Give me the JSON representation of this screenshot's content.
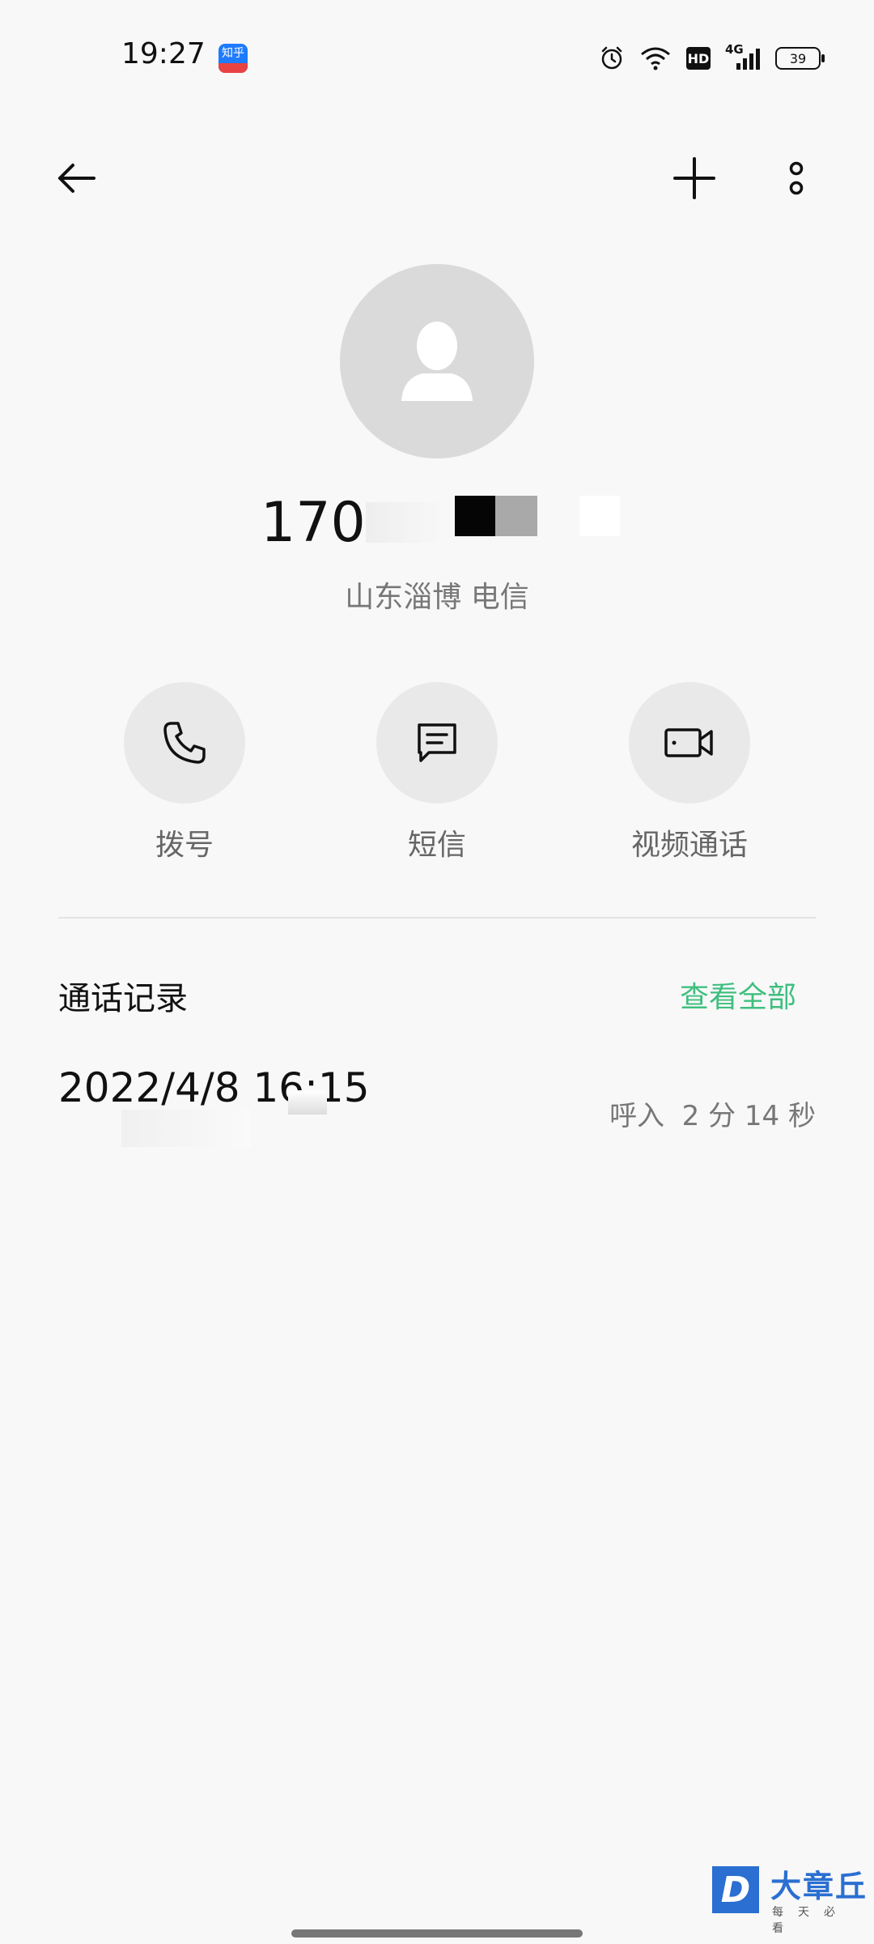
{
  "status_bar": {
    "time": "19:27",
    "app_icon": "zhihu-icon",
    "app_icon_text": "知乎",
    "network": "4G",
    "hd": "HD",
    "battery": "39"
  },
  "toolbar": {
    "back_icon": "back-arrow-icon",
    "add_icon": "plus-icon",
    "more_icon": "more-vertical-icon"
  },
  "contact": {
    "avatar_icon": "person-icon",
    "number_visible": "170",
    "location": "山东淄博 电信"
  },
  "actions": [
    {
      "label": "拨号",
      "icon": "phone-icon"
    },
    {
      "label": "短信",
      "icon": "message-icon"
    },
    {
      "label": "视频通话",
      "icon": "video-icon"
    }
  ],
  "call_log": {
    "title": "通话记录",
    "view_all": "查看全部",
    "entries": [
      {
        "datetime": "2022/4/8 16:15",
        "detail": "呼入  2 分 14 秒"
      }
    ]
  },
  "watermark": {
    "title": "大章丘",
    "subtitle": "每天必看"
  },
  "colors": {
    "accent": "#3fbf7f",
    "background": "#f8f8f8"
  }
}
